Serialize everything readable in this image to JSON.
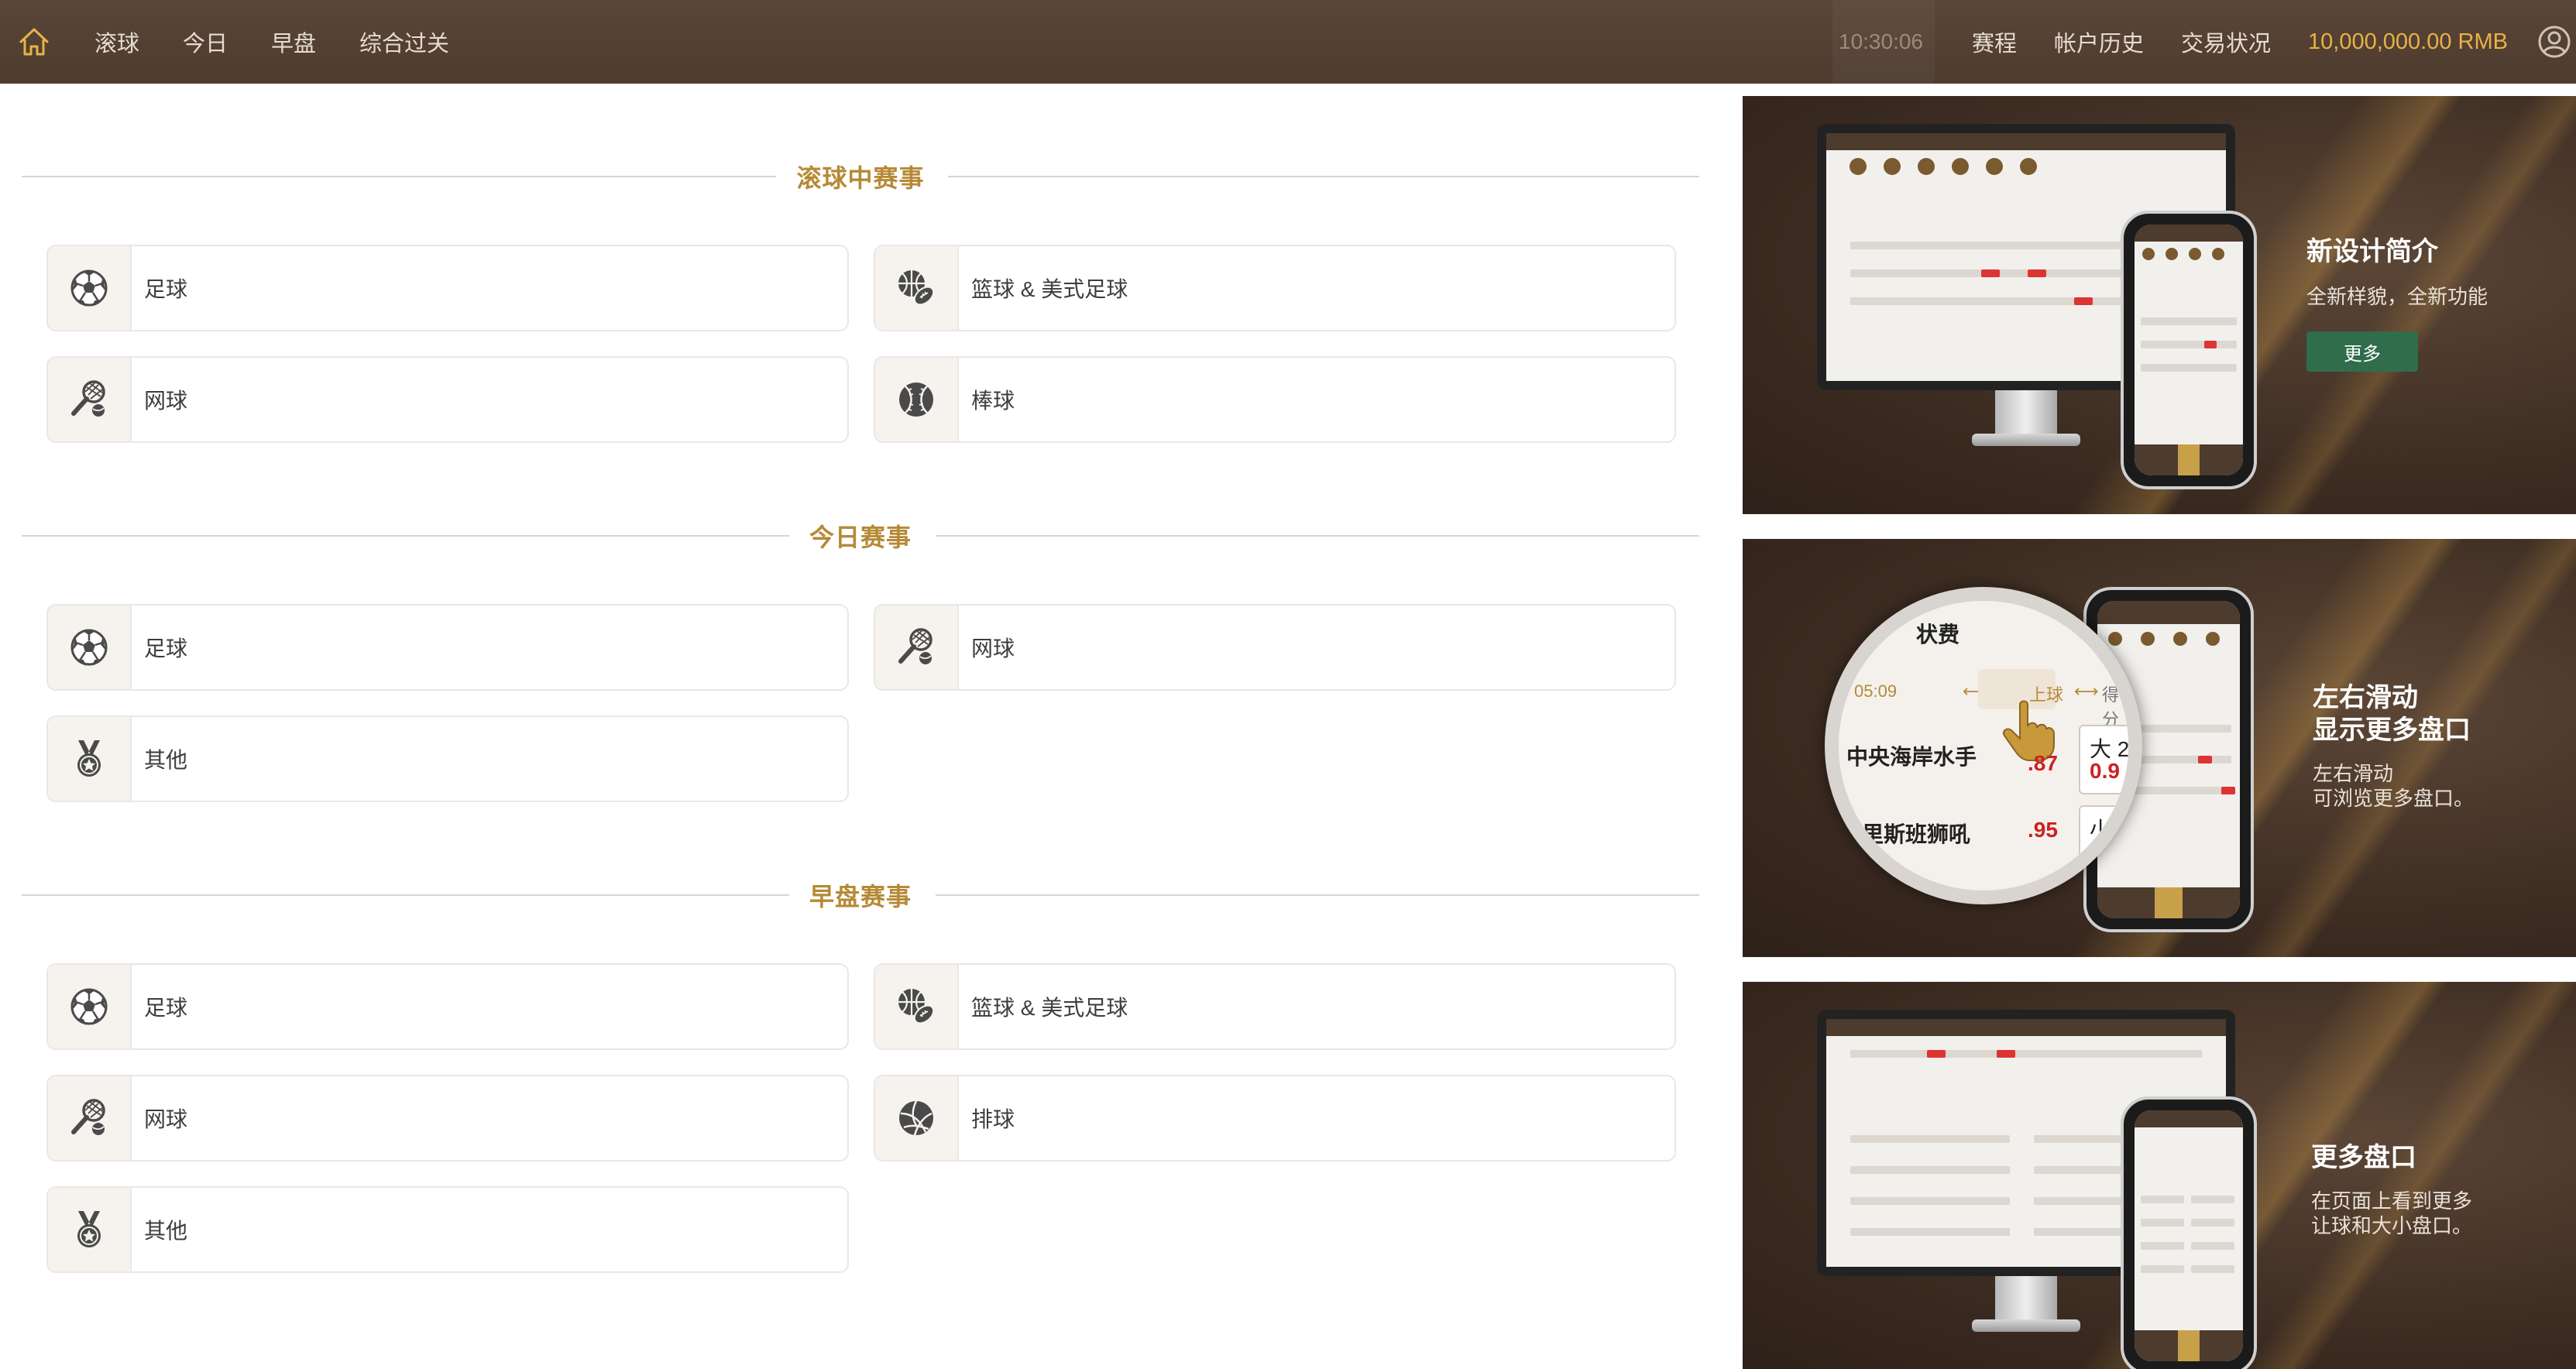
{
  "topbar": {
    "nav_left": [
      "滚球",
      "今日",
      "早盘",
      "综合过关"
    ],
    "clock": "10:30:06",
    "nav_right": [
      "赛程",
      "帐户历史",
      "交易状况"
    ],
    "balance": "10,000,000.00 RMB",
    "icons": {
      "home": "home-icon",
      "user": "user-icon"
    },
    "colors": {
      "bar": "#4d3b2e",
      "balance": "#e8b248",
      "accent": "#b58a36"
    }
  },
  "sections": [
    {
      "title": "滚球中赛事",
      "items": [
        {
          "label": "足球",
          "icon": "soccer-ball-icon"
        },
        {
          "label": "篮球 & 美式足球",
          "icon": "basketball-football-icon"
        },
        {
          "label": "网球",
          "icon": "tennis-icon"
        },
        {
          "label": "棒球",
          "icon": "baseball-icon"
        }
      ]
    },
    {
      "title": "今日赛事",
      "items": [
        {
          "label": "足球",
          "icon": "soccer-ball-icon"
        },
        {
          "label": "网球",
          "icon": "tennis-icon"
        },
        {
          "label": "其他",
          "icon": "medal-icon"
        }
      ]
    },
    {
      "title": "早盘赛事",
      "items": [
        {
          "label": "足球",
          "icon": "soccer-ball-icon"
        },
        {
          "label": "篮球 & 美式足球",
          "icon": "basketball-football-icon"
        },
        {
          "label": "网球",
          "icon": "tennis-icon"
        },
        {
          "label": "排球",
          "icon": "volleyball-icon"
        },
        {
          "label": "其他",
          "icon": "medal-icon"
        }
      ]
    }
  ],
  "banners": [
    {
      "title": "新设计简介",
      "subtitle": "全新样貌，全新功能",
      "button": "更多"
    },
    {
      "title_line1": "左右滑动",
      "title_line2": "显示更多盘口",
      "subtitle_line1": "左右滑动",
      "subtitle_line2": "可浏览更多盘口。"
    },
    {
      "title": "更多盘口",
      "subtitle_line1": "在页面上看到更多",
      "subtitle_line2": "让球和大小盘口。"
    }
  ],
  "magnifier": {
    "row0": "状费",
    "time": "05:09",
    "tab": "上球",
    "tab2": "得分",
    "team1": "中央海岸水手",
    "odd1": ".87",
    "box1_label": "大 2",
    "box1_odd": "0.9",
    "team2": "里斯班狮吼",
    "odd2": ".95",
    "box2_label": "小"
  }
}
